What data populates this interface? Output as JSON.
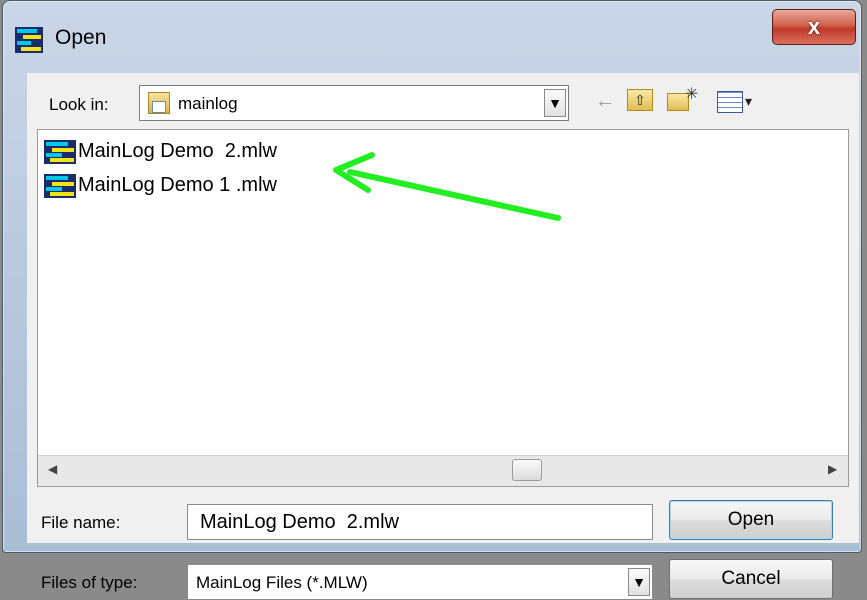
{
  "window": {
    "title": "Open",
    "close_label": "x"
  },
  "lookin": {
    "label": "Look in:",
    "value": "mainlog",
    "dropdown_glyph": "▼"
  },
  "toolbar": {
    "back_glyph": "←",
    "up_glyph": "⇧",
    "new_folder_spark": "✳",
    "views_arrow": "▾"
  },
  "files": [
    {
      "name": "MainLog Demo  2.mlw"
    },
    {
      "name": "MainLog Demo 1 .mlw"
    }
  ],
  "scrollbar": {
    "left_arrow": "◀",
    "right_arrow": "▶"
  },
  "filename": {
    "label": "File name:",
    "value": "MainLog Demo  2.mlw"
  },
  "filetype": {
    "label": "Files of type:",
    "value": "MainLog Files (*.MLW)",
    "dropdown_glyph": "▼"
  },
  "buttons": {
    "open": "Open",
    "cancel": "Cancel"
  },
  "colors": {
    "annotation_arrow": "#22ee22",
    "icon_cyan": "#00c8e8",
    "icon_yellow": "#f6e21a",
    "icon_dark": "#1a2c6a"
  }
}
